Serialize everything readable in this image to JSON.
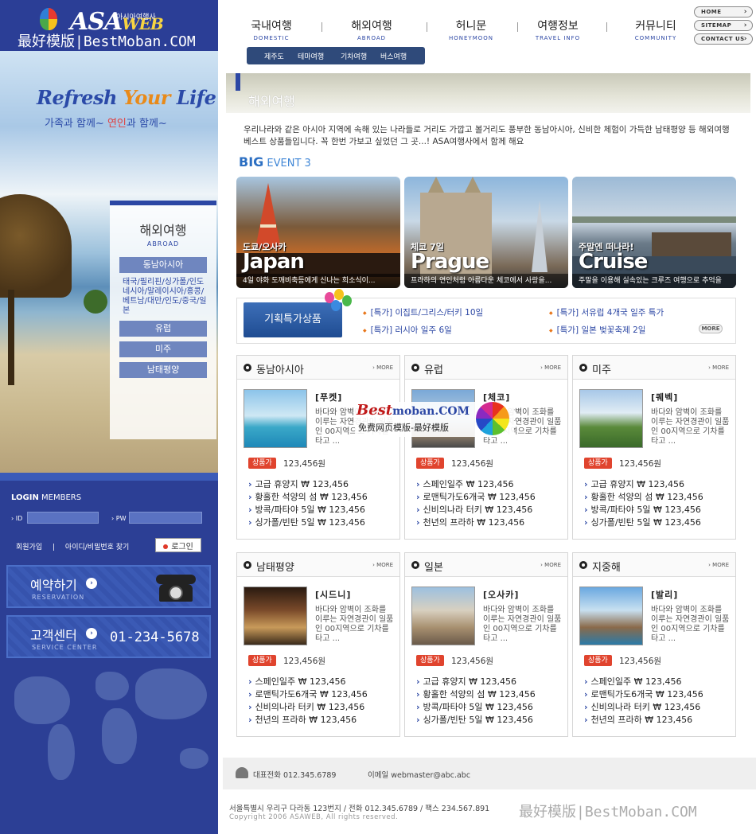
{
  "watermarks": {
    "top": "最好模版|BestMoban.COM",
    "center_brand": "Best",
    "center_brand_com": "moban.COM",
    "center_sub": "免费网页模版-最好模版",
    "bottom": "最好模版|BestMoban.COM"
  },
  "logo": {
    "main": "ASA",
    "accent": "WEB",
    "sub": "아시아여행사"
  },
  "hero": {
    "slogan_prefix": "Refresh ",
    "slogan_accent": "Your",
    "slogan_suffix": " Life",
    "tagline_a": "가족과 함께~ ",
    "tagline_accent": "연인",
    "tagline_b": "과 함께~"
  },
  "side_menu": {
    "title": "해외여행",
    "subtitle": "ABROAD",
    "items": [
      "동남아시아",
      "유럽",
      "미주",
      "남태평양"
    ],
    "countries": "태국/필리핀/싱가폴/인도네시아/말레이시아/홍콩/베트남/대만/인도/중국/일본"
  },
  "login": {
    "title_bold": "LOGIN",
    "title_thin": " MEMBERS",
    "id_label": "› ID",
    "pw_label": "› PW",
    "join": "회원가입",
    "sep": "|",
    "find": "아이디/비밀번호 찾기",
    "button": "로그인"
  },
  "reservation": {
    "label": "예약하기",
    "sub": "RESERVATION",
    "arrow": "›"
  },
  "service": {
    "label": "고객센터",
    "sub": "SERVICE CENTER",
    "phone": "01-234-5678",
    "arrow": "›"
  },
  "gnb": [
    {
      "ko": "국내여행",
      "en": "DOMESTIC"
    },
    {
      "ko": "해외여행",
      "en": "ABROAD"
    },
    {
      "ko": "허니문",
      "en": "HONEYMOON"
    },
    {
      "ko": "여행정보",
      "en": "TRAVEL INFO"
    },
    {
      "ko": "커뮤니티",
      "en": "COMMUNITY"
    }
  ],
  "subnav": [
    "제주도",
    "테마여행",
    "기차여행",
    "버스여행"
  ],
  "util": [
    "HOME",
    "SITEMAP",
    "CONTACT US"
  ],
  "page": {
    "title": "해외여행",
    "intro": "우리나라와 같은 아시아 지역에 속해 있는 나라들로 거리도 가깝고 볼거리도 풍부한 동남아시아, 신비한 체험이 가득한 남태평양 등 해외여행 베스트 상품들입니다. 꼭 한번 가보고 싶었던 그 곳...! ASA여행사에서 함께 해요"
  },
  "big_event": {
    "title_bold": "BIG",
    "title_thin": " EVENT 3",
    "cards": [
      {
        "place": "도쿄/오사카",
        "name": "Japan",
        "caption": "4일 야화 도깨비축등에게 신나는 희소식이..."
      },
      {
        "place": "체코 7일",
        "name": "Prague",
        "caption": "프라하의 연인처럼 아름다운 체코에서 사랑을..."
      },
      {
        "place": "주말엔 떠나라!",
        "name": "Cruise",
        "caption": "주말을 이용해 실속있는 크루즈 여행으로 추억을"
      }
    ]
  },
  "special": {
    "badge": "기획특가상품",
    "links": [
      "[특가] 이집트/그리스/터키 10일",
      "[특가] 서유럽 4개국 일주 특가",
      "[특가] 러시아 일주 6일",
      "[특가] 일본 벚꽃축제 2일"
    ],
    "more": "MORE"
  },
  "regions": [
    {
      "title": "동남아시아",
      "more": "› MORE",
      "city": "[푸켓]",
      "desc": "바다와 암벽이 조화를 이루는 자연경관이 일품인 00지역으로 기차를 타고 ...",
      "price_tag": "상품가",
      "price": "123,456원",
      "items": [
        "고급 휴양지 ₩ 123,456",
        "황홀한 석양의 섬 ₩ 123,456",
        "방콕/파타야 5일 ₩ 123,456",
        "싱가폴/빈탄 5일 ₩ 123,456"
      ]
    },
    {
      "title": "유럽",
      "more": "› MORE",
      "city": "[체코]",
      "desc": "바다와 암벽이 조화를 이루는 자연경관이 일품인 00지역으로 기차를 타고 ...",
      "price_tag": "상품가",
      "price": "123,456원",
      "items": [
        "스페인일주 ₩ 123,456",
        "로맨틱가도6개국 ₩ 123,456",
        "신비의나라 터키 ₩ 123,456",
        "천년의 프라하 ₩ 123,456"
      ]
    },
    {
      "title": "미주",
      "more": "› MORE",
      "city": "[퀘벡]",
      "desc": "바다와 암벽이 조화를 이루는 자연경관이 일품인 00지역으로 기차를 타고 ...",
      "price_tag": "상품가",
      "price": "123,456원",
      "items": [
        "고급 휴양지 ₩ 123,456",
        "황홀한 석양의 섬 ₩ 123,456",
        "방콕/파타야 5일 ₩ 123,456",
        "싱가폴/빈탄 5일 ₩ 123,456"
      ]
    },
    {
      "title": "남태평양",
      "more": "› MORE",
      "city": "[시드니]",
      "desc": "바다와 암벽이 조화를 이루는 자연경관이 일품인 00지역으로 기차를 타고 ...",
      "price_tag": "상품가",
      "price": "123,456원",
      "items": [
        "스페인일주 ₩ 123,456",
        "로맨틱가도6개국 ₩ 123,456",
        "신비의나라 터키 ₩ 123,456",
        "천년의 프라하 ₩ 123,456"
      ]
    },
    {
      "title": "일본",
      "more": "› MORE",
      "city": "[오사카]",
      "desc": "바다와 암벽이 조화를 이루는 자연경관이 일품인 00지역으로 기차를 타고 ...",
      "price_tag": "상품가",
      "price": "123,456원",
      "items": [
        "고급 휴양지 ₩ 123,456",
        "황홀한 석양의 섬 ₩ 123,456",
        "방콕/파타야 5일 ₩ 123,456",
        "싱가폴/빈탄 5일 ₩ 123,456"
      ]
    },
    {
      "title": "지중해",
      "more": "› MORE",
      "city": "[발리]",
      "desc": "바다와 암벽이 조화를 이루는 자연경관이 일품인 00지역으로 기차를 타고 ...",
      "price_tag": "상품가",
      "price": "123,456원",
      "items": [
        "스페인일주 ₩ 123,456",
        "로맨틱가도6개국 ₩ 123,456",
        "신비의나라 터키 ₩ 123,456",
        "천년의 프라하 ₩ 123,456"
      ]
    }
  ],
  "footer": {
    "tel": "대표전화 012.345.6789",
    "mail": "이메일   webmaster@abc.abc",
    "address": "서울특별시 우리구 다라동 123번지 / 전화 012.345.6789  /  팩스  234.567.891",
    "copyright": "Copyright 2006 ASAWEB, All rights reserved."
  },
  "colors": {
    "brand_blue": "#2c3f95",
    "accent_orange": "#e8761a",
    "price_red": "#e0442e"
  }
}
